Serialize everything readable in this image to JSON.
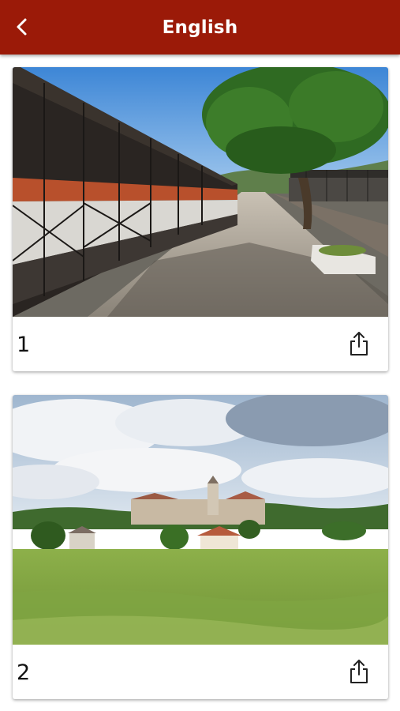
{
  "header": {
    "title": "English",
    "back_icon": "chevron-left-icon",
    "background_color": "#9b1a08",
    "title_color": "#ffffff"
  },
  "cards": [
    {
      "number": "1",
      "image": "railway-station-platform-with-freight-wagons-and-trees",
      "share_icon": "share-icon"
    },
    {
      "number": "2",
      "image": "village-with-church-tower-behind-green-meadow",
      "share_icon": "share-icon"
    }
  ]
}
